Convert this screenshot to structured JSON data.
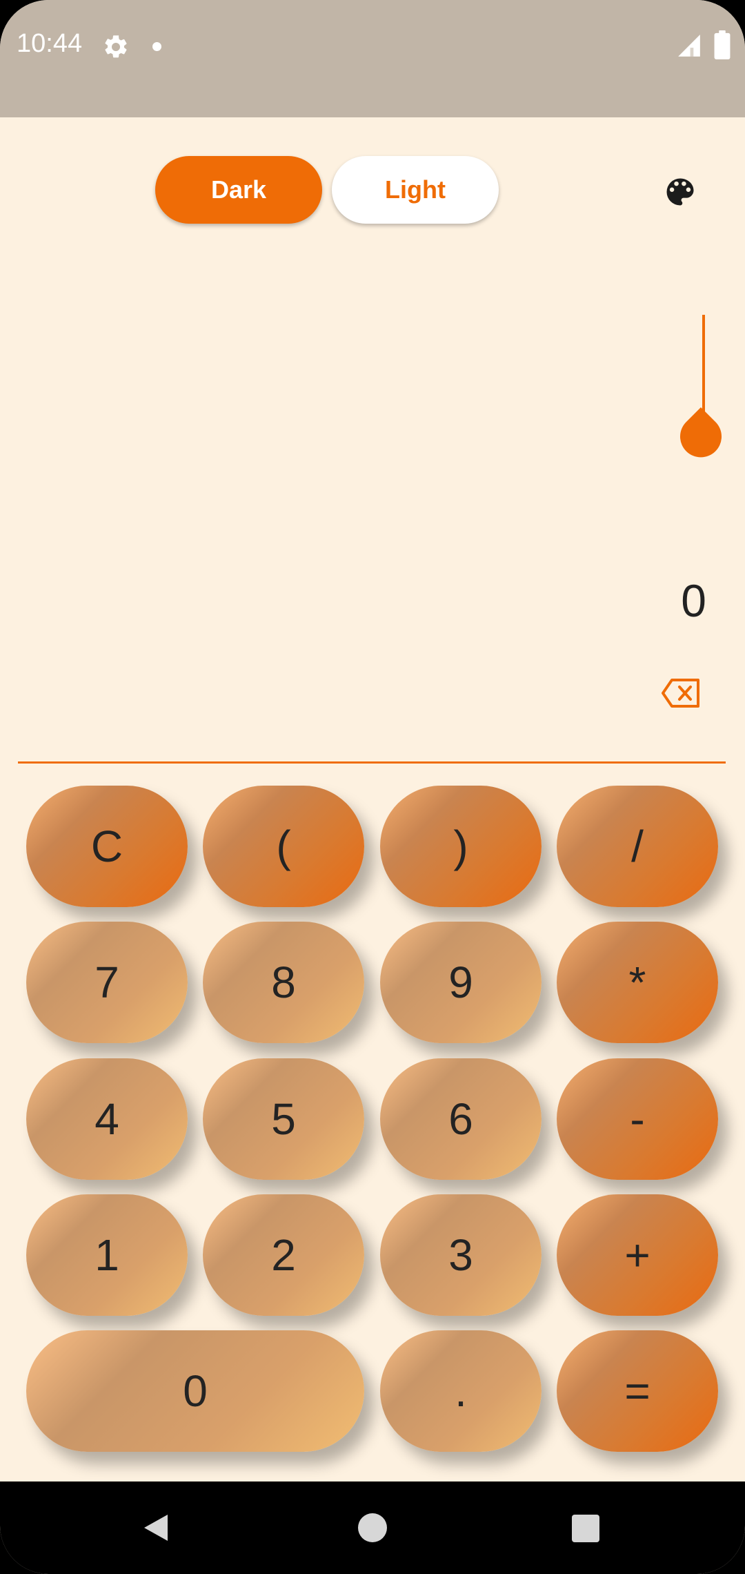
{
  "status_bar": {
    "time": "10:44"
  },
  "theme_toggle": {
    "dark_label": "Dark",
    "light_label": "Light"
  },
  "colors": {
    "accent": "#ef6c06",
    "background": "#fdf1e0",
    "status_bar": "#c1b5a7"
  },
  "display": {
    "value": "0"
  },
  "keys": [
    {
      "label": "C",
      "type": "op"
    },
    {
      "label": "(",
      "type": "op"
    },
    {
      "label": ")",
      "type": "op"
    },
    {
      "label": "/",
      "type": "op"
    },
    {
      "label": "7",
      "type": "num"
    },
    {
      "label": "8",
      "type": "num"
    },
    {
      "label": "9",
      "type": "num"
    },
    {
      "label": "*",
      "type": "op"
    },
    {
      "label": "4",
      "type": "num"
    },
    {
      "label": "5",
      "type": "num"
    },
    {
      "label": "6",
      "type": "num"
    },
    {
      "label": "-",
      "type": "op"
    },
    {
      "label": "1",
      "type": "num"
    },
    {
      "label": "2",
      "type": "num"
    },
    {
      "label": "3",
      "type": "num"
    },
    {
      "label": "+",
      "type": "op"
    },
    {
      "label": "0",
      "type": "num"
    },
    {
      "label": ".",
      "type": "num"
    },
    {
      "label": "=",
      "type": "op"
    }
  ],
  "icons": {
    "settings": "gear-icon",
    "palette": "palette-icon",
    "backspace": "backspace-icon",
    "slider": "slider-handle",
    "nav_back": "back-icon",
    "nav_home": "home-icon",
    "nav_recent": "recents-icon"
  }
}
